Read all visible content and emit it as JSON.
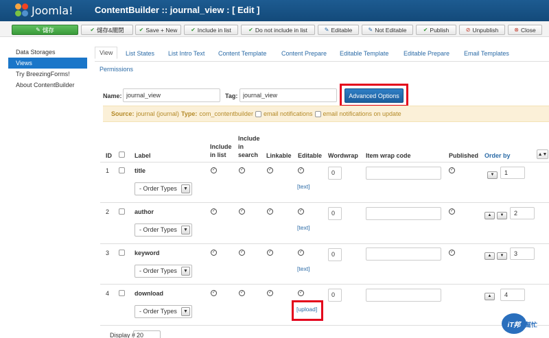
{
  "header": {
    "brand": "Joomla!",
    "title": "ContentBuilder :: journal_view : [ Edit ]",
    "colors": {
      "bar": "#1d5b91",
      "accent": "#3a9b3a",
      "highlight_frame": "#e3001b"
    }
  },
  "toolbar": {
    "buttons": [
      {
        "label": "儲存",
        "icon": "edit-icon"
      },
      {
        "label": "儲存&關閉",
        "icon": "check-icon"
      },
      {
        "label": "Save + New",
        "icon": "check-icon"
      },
      {
        "label": "Include in list",
        "icon": "check-icon"
      },
      {
        "label": "Do not include in list",
        "icon": "check-icon"
      },
      {
        "label": "Editable",
        "icon": "edit-icon"
      },
      {
        "label": "Not Editable",
        "icon": "edit-icon"
      },
      {
        "label": "Publish",
        "icon": "check-icon"
      },
      {
        "label": "Unpublish",
        "icon": "unpublish-icon"
      },
      {
        "label": "Close",
        "icon": "close-icon"
      }
    ]
  },
  "sidebar": {
    "items": [
      {
        "label": "Data Storages"
      },
      {
        "label": "Views",
        "active": true
      },
      {
        "label": "Try BreezingForms!"
      },
      {
        "label": "About ContentBuilder"
      }
    ]
  },
  "tabs": [
    {
      "label": "View",
      "active": true
    },
    {
      "label": "List States"
    },
    {
      "label": "List Intro Text"
    },
    {
      "label": "Content Template"
    },
    {
      "label": "Content Prepare"
    },
    {
      "label": "Editable Template"
    },
    {
      "label": "Editable Prepare"
    },
    {
      "label": "Email Templates"
    },
    {
      "label": "Permissions"
    }
  ],
  "form": {
    "name_label": "Name:",
    "name_value": "journal_view",
    "tag_label": "Tag:",
    "tag_value": "journal_view",
    "advanced_button": "Advanced Options"
  },
  "source": {
    "prefix": "Source:",
    "source_value": "journal (journal)",
    "type_label": "Type:",
    "type_value": "com_contentbuilder",
    "email_notifications": "email notifications",
    "email_notifications_update": "email notifications on update"
  },
  "table": {
    "headers": {
      "id": "ID",
      "label": "Label",
      "include_list": "Include in list",
      "include_search_1": "Include",
      "include_search_2": "in",
      "include_search_3": "search",
      "linkable": "Linkable",
      "editable": "Editable",
      "wordwrap": "Wordwrap",
      "item_wrap": "Item wrap code",
      "published": "Published",
      "order_by": "Order by"
    },
    "rows": [
      {
        "id": "1",
        "label": "title",
        "order_types": "- Order Types",
        "edit_link": "[text]",
        "wordwrap": "0",
        "order": "1"
      },
      {
        "id": "2",
        "label": "author",
        "order_types": "- Order Types",
        "edit_link": "[text]",
        "wordwrap": "0",
        "order": "2"
      },
      {
        "id": "3",
        "label": "keyword",
        "order_types": "- Order Types",
        "edit_link": "[text]",
        "wordwrap": "0",
        "order": "3"
      },
      {
        "id": "4",
        "label": "download",
        "order_types": "- Order Types",
        "edit_link": "[upload]",
        "wordwrap": "0",
        "order": "4"
      }
    ]
  },
  "footer": {
    "display_label": "Display #",
    "display_value": "20"
  },
  "watermark": {
    "badge": "iT邦",
    "text": "幫忙"
  }
}
